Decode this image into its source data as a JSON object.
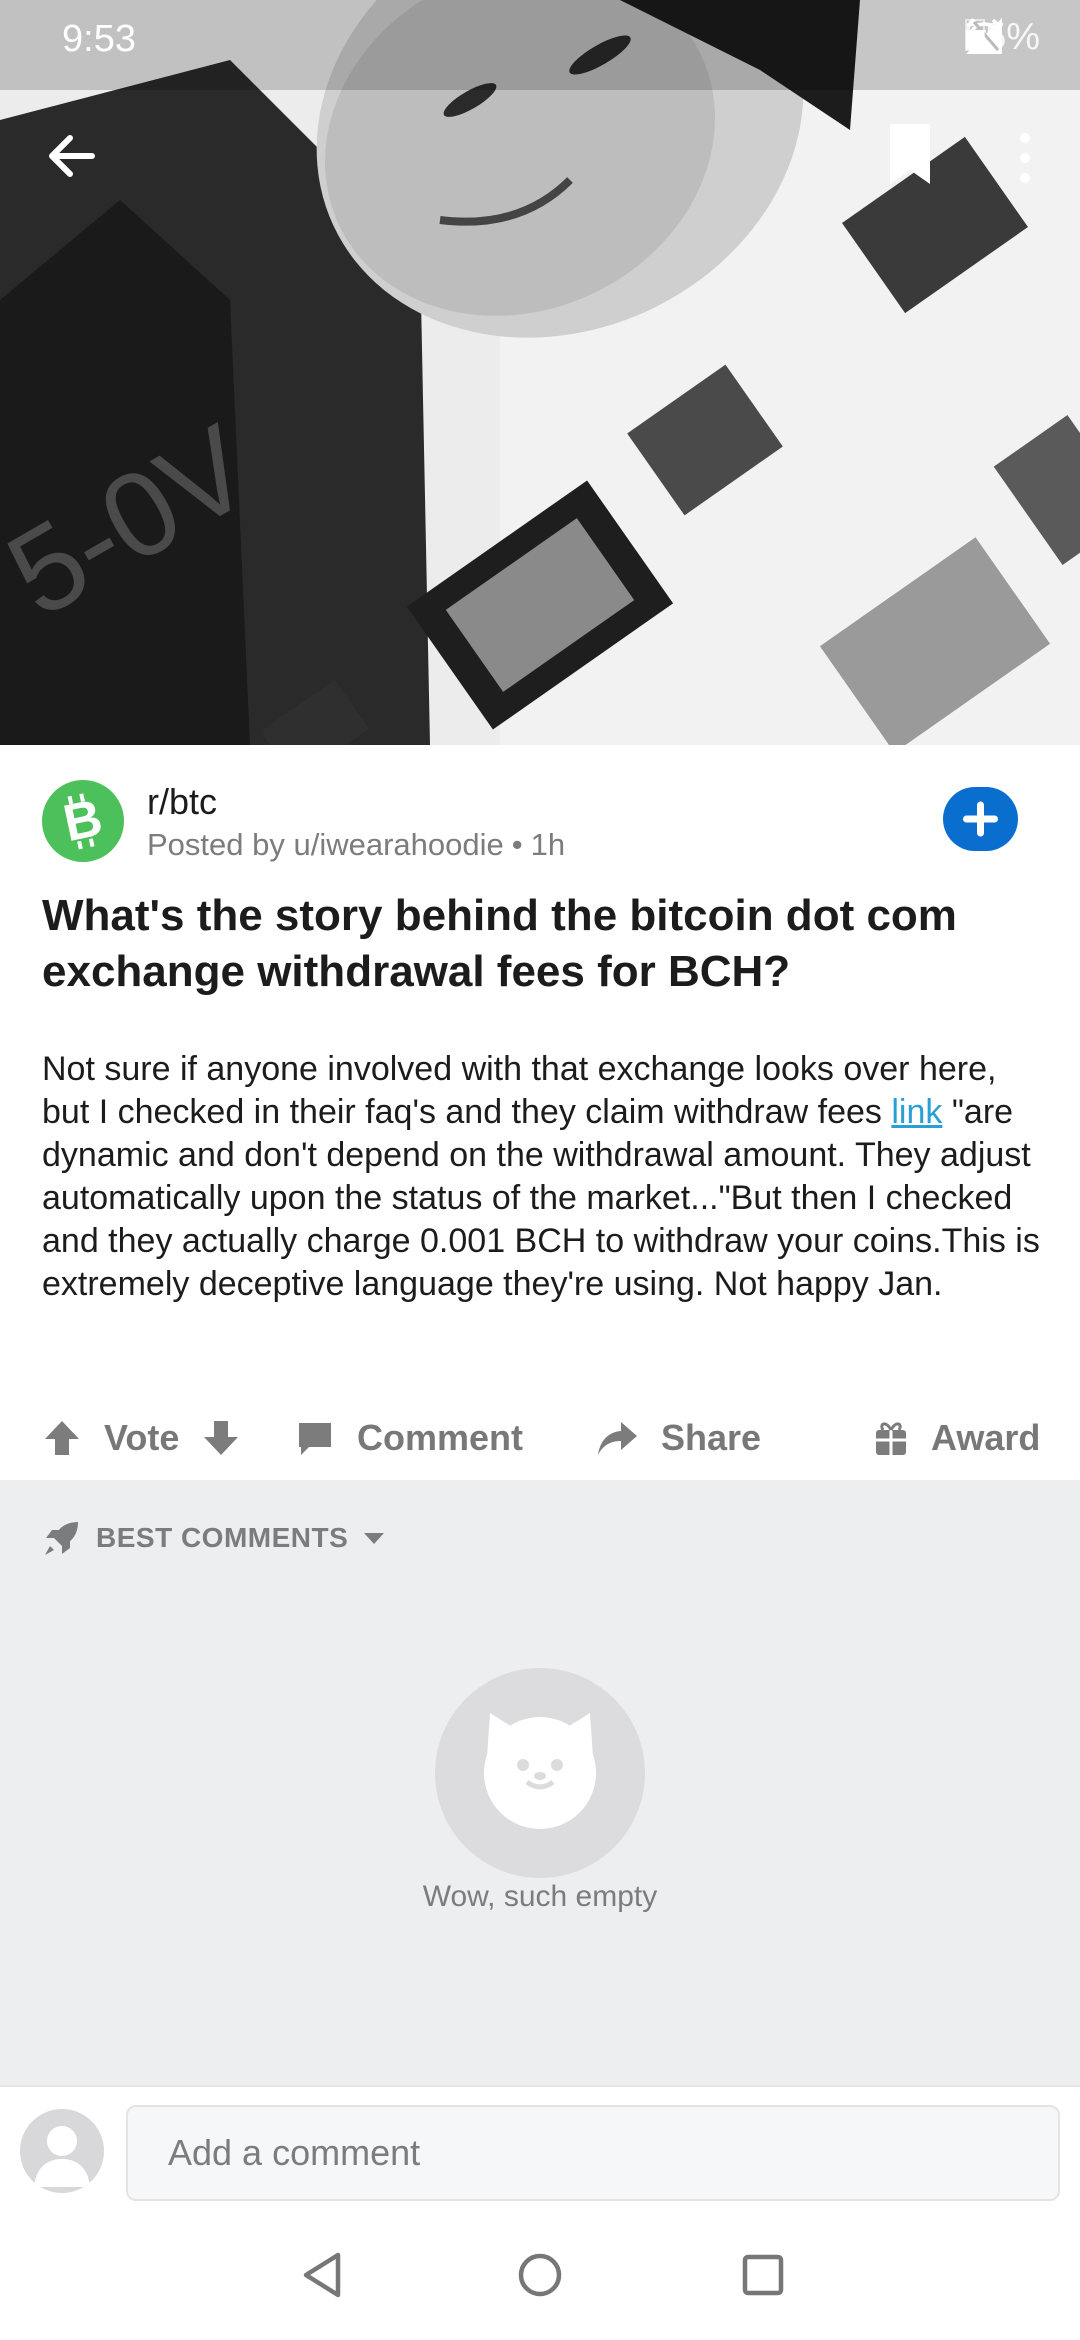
{
  "status_bar": {
    "time": "9:53",
    "battery": "55%"
  },
  "post": {
    "subreddit": "r/btc",
    "posted_by": "Posted by u/iwearahoodie",
    "separator": "•",
    "age": "1h",
    "title": "What's the story behind the bitcoin dot com exchange withdrawal fees for BCH?",
    "body_before_link": "Not sure if anyone involved with that exchange looks over here, but I checked in their faq's and they claim withdraw fees ",
    "body_link": "link",
    "body_after_link": " \"are dynamic and don't depend on the withdrawal amount. They adjust automatically upon the status of the market...\"But then I checked and they actually charge 0.001 BCH to withdraw your coins.This is extremely deceptive language they're using. Not happy Jan."
  },
  "actions": {
    "vote": "Vote",
    "comment": "Comment",
    "share": "Share",
    "award": "Award"
  },
  "comments": {
    "sort_label": "BEST COMMENTS",
    "empty_text": "Wow, such empty"
  },
  "composer": {
    "placeholder": "Add a comment"
  },
  "colors": {
    "accent_blue": "#0a6ecf",
    "subreddit_green": "#4cc05a",
    "link_blue": "#2a9fd6",
    "comments_bg": "#edeef0"
  },
  "icons": {
    "back": "arrow-left-icon",
    "bookmark": "bookmark-icon",
    "more": "more-vertical-icon",
    "upvote": "arrow-up-icon",
    "downvote": "arrow-down-icon",
    "comment": "comment-icon",
    "share": "share-icon",
    "award": "gift-icon",
    "sort": "rocket-icon",
    "empty": "cat-icon"
  }
}
